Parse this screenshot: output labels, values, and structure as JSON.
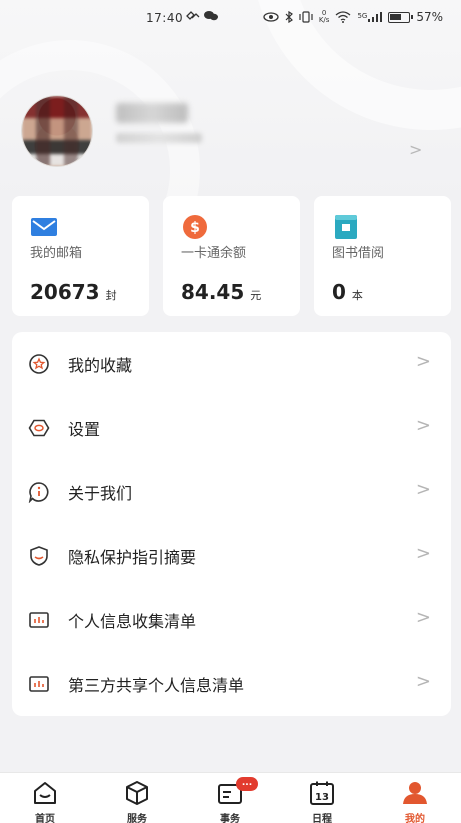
{
  "status_bar": {
    "time": "17:40",
    "battery": "57%",
    "net_speed_top": "0",
    "net_speed_unit": "K/s",
    "signal_label": "5G"
  },
  "stats": [
    {
      "label": "我的邮箱",
      "value": "20673",
      "unit": "封",
      "icon": "mail-icon",
      "color": "#2f7fe0"
    },
    {
      "label": "一卡通余额",
      "value": "84.45",
      "unit": "元",
      "icon": "dollar-coin-icon",
      "color": "#ef6a3c"
    },
    {
      "label": "图书借阅",
      "value": "0",
      "unit": "本",
      "icon": "book-icon",
      "color": "#2ba9c0"
    }
  ],
  "menu": [
    {
      "label": "我的收藏",
      "icon": "star-favorite-icon"
    },
    {
      "label": "设置",
      "icon": "settings-hexagon-icon"
    },
    {
      "label": "关于我们",
      "icon": "info-bubble-icon"
    },
    {
      "label": "隐私保护指引摘要",
      "icon": "shield-icon"
    },
    {
      "label": "个人信息收集清单",
      "icon": "chart-list-icon"
    },
    {
      "label": "第三方共享个人信息清单",
      "icon": "chart-list-icon"
    }
  ],
  "arrow_glyph": ">",
  "nav": [
    {
      "label": "首页",
      "icon": "home-icon"
    },
    {
      "label": "服务",
      "icon": "cube-icon"
    },
    {
      "label": "事务",
      "icon": "inbox-card-icon",
      "badge": "..."
    },
    {
      "label": "日程",
      "icon": "calendar-icon",
      "day": "13"
    },
    {
      "label": "我的",
      "icon": "person-icon",
      "active": true
    }
  ],
  "accent_color": "#e2572f"
}
